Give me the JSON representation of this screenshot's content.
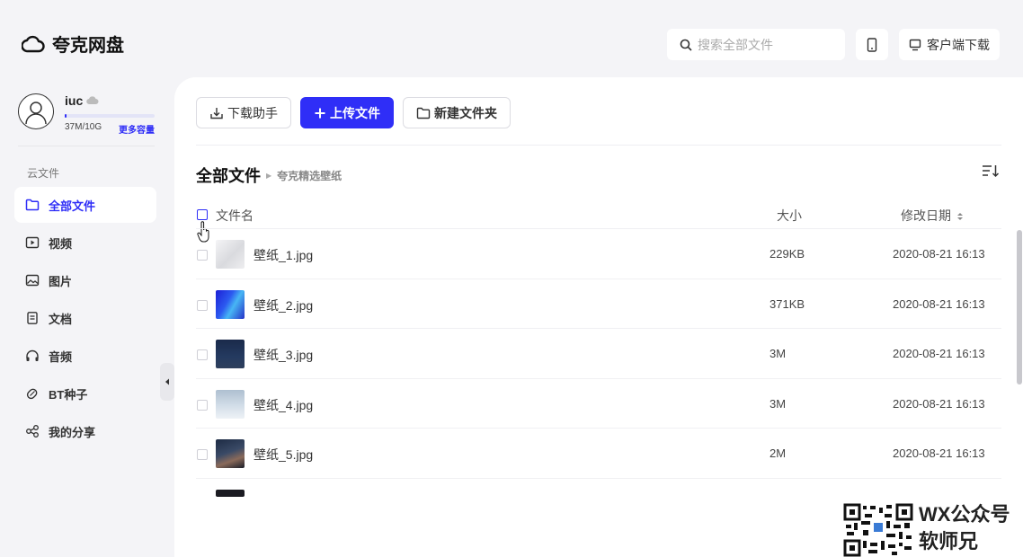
{
  "app": {
    "name": "夸克网盘"
  },
  "header": {
    "search_placeholder": "搜索全部文件",
    "client_download": "客户端下载"
  },
  "user": {
    "name": "iuc",
    "quota_used_fraction": 0.0037,
    "quota_text": "37M/10G",
    "more_capacity": "更多容量"
  },
  "sidebar": {
    "section": "云文件",
    "items": [
      {
        "label": "全部文件",
        "icon": "folder-icon",
        "active": true
      },
      {
        "label": "视频",
        "icon": "video-icon"
      },
      {
        "label": "图片",
        "icon": "image-icon"
      },
      {
        "label": "文档",
        "icon": "document-icon"
      },
      {
        "label": "音频",
        "icon": "headphones-icon"
      },
      {
        "label": "BT种子",
        "icon": "bt-seed-icon"
      },
      {
        "label": "我的分享",
        "icon": "share-icon"
      }
    ]
  },
  "toolbar": {
    "download_helper": "下载助手",
    "upload": "上传文件",
    "new_folder": "新建文件夹"
  },
  "breadcrumb": {
    "root": "全部文件",
    "current": "夸克精选壁纸"
  },
  "table": {
    "col_name": "文件名",
    "col_size": "大小",
    "col_date": "修改日期",
    "rows": [
      {
        "name": "壁纸_1.jpg",
        "size": "229KB",
        "date": "2020-08-21 16:13"
      },
      {
        "name": "壁纸_2.jpg",
        "size": "371KB",
        "date": "2020-08-21 16:13"
      },
      {
        "name": "壁纸_3.jpg",
        "size": "3M",
        "date": "2020-08-21 16:13"
      },
      {
        "name": "壁纸_4.jpg",
        "size": "3M",
        "date": "2020-08-21 16:13"
      },
      {
        "name": "壁纸_5.jpg",
        "size": "2M",
        "date": "2020-08-21 16:13"
      }
    ]
  },
  "watermark": {
    "line1": "WX公众号",
    "line2": "软师兄"
  },
  "colors": {
    "accent": "#2f2ef7",
    "background": "#f4f4f7"
  }
}
